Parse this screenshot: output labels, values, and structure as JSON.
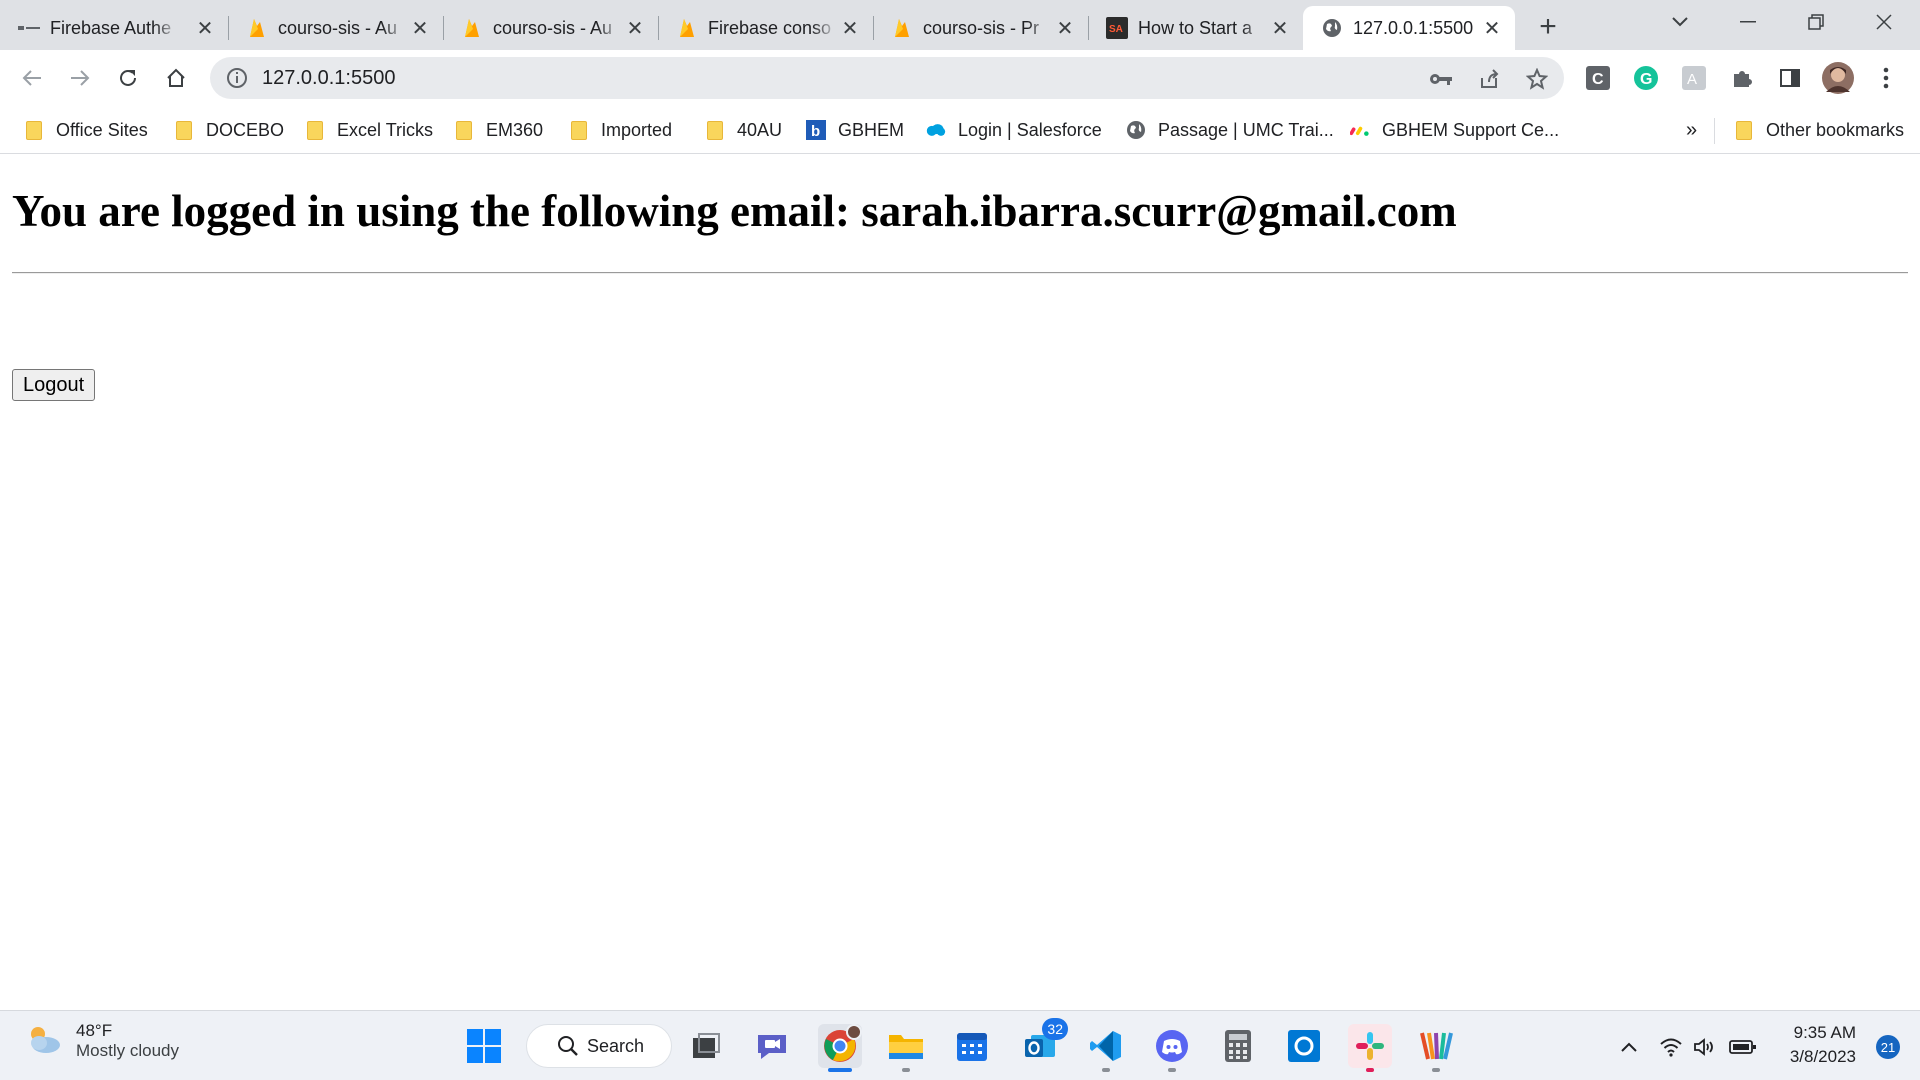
{
  "browser": {
    "tabs": [
      {
        "title": "Firebase Authe",
        "favicon": "firebase-docs-icon"
      },
      {
        "title": "courso-sis - Au",
        "favicon": "firebase-flame-icon"
      },
      {
        "title": "courso-sis - Au",
        "favicon": "firebase-flame-icon"
      },
      {
        "title": "Firebase conso",
        "favicon": "firebase-flame-icon"
      },
      {
        "title": "courso-sis - Pr",
        "favicon": "firebase-flame-icon"
      },
      {
        "title": "How to Start a",
        "favicon": "sa-logo-icon"
      },
      {
        "title": "127.0.0.1:5500",
        "favicon": "globe-icon",
        "active": true
      }
    ],
    "url": "127.0.0.1:5500",
    "bookmarks": [
      {
        "label": "Office Sites",
        "icon": "folder-icon"
      },
      {
        "label": "DOCEBO",
        "icon": "folder-icon"
      },
      {
        "label": "Excel Tricks",
        "icon": "folder-icon"
      },
      {
        "label": "EM360",
        "icon": "folder-icon"
      },
      {
        "label": "Imported",
        "icon": "folder-icon"
      },
      {
        "label": "40AU",
        "icon": "folder-icon"
      },
      {
        "label": "GBHEM",
        "icon": "b-logo-icon"
      },
      {
        "label": "Login | Salesforce",
        "icon": "salesforce-cloud-icon"
      },
      {
        "label": "Passage | UMC Trai...",
        "icon": "globe-icon"
      },
      {
        "label": "GBHEM Support Ce...",
        "icon": "monday-logo-icon"
      }
    ],
    "more_bookmarks": "»",
    "other_bookmarks": "Other bookmarks"
  },
  "page": {
    "heading": "You are logged in using the following email: sarah.ibarra.scurr@gmail.com",
    "logout_label": "Logout"
  },
  "taskbar": {
    "weather_temp": "48°F",
    "weather_desc": "Mostly cloudy",
    "search_label": "Search",
    "outlook_badge": "32",
    "time": "9:35 AM",
    "date": "3/8/2023",
    "notification_count": "21"
  },
  "colors": {
    "tab_strip": "#dfe1e5",
    "omnibox": "#e8eaed",
    "accent_blue": "#1a73e8",
    "folder_yellow": "#f9d65c"
  }
}
